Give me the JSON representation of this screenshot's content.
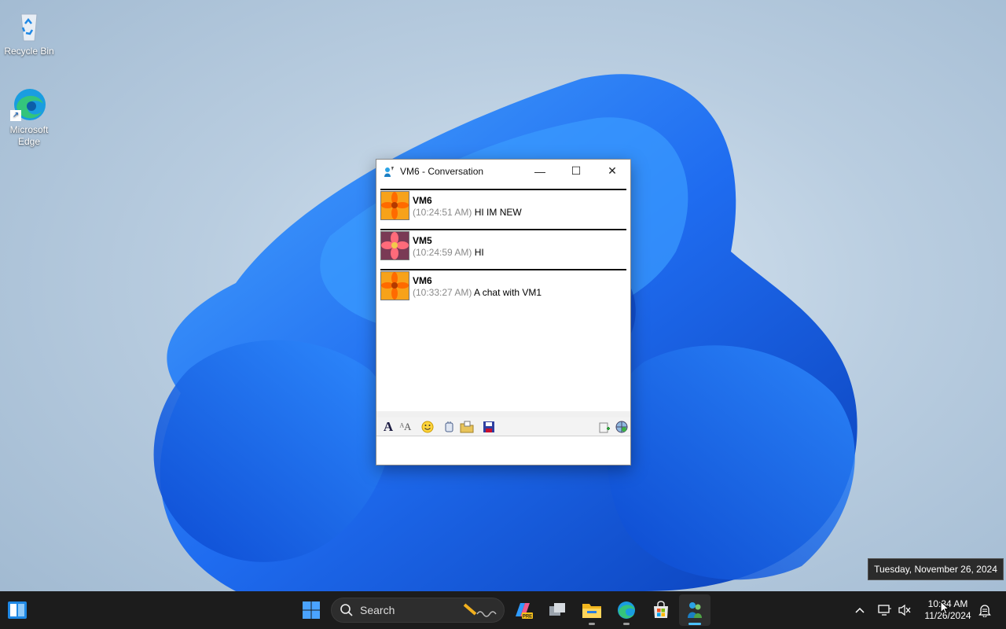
{
  "desktop": {
    "icons": [
      {
        "label": "Recycle Bin"
      },
      {
        "label": "Microsoft Edge"
      }
    ]
  },
  "window": {
    "title": "VM6 - Conversation",
    "controls": {
      "minimize": "—",
      "maximize": "☐",
      "close": "✕"
    },
    "messages": [
      {
        "sender": "VM6",
        "time": "(10:24:51 AM)",
        "text": "HI IM NEW",
        "avatar": "orange-flower"
      },
      {
        "sender": "VM5",
        "time": "(10:24:59 AM)",
        "text": "HI",
        "avatar": "pink-flower"
      },
      {
        "sender": "VM6",
        "time": "(10:33:27 AM)",
        "text": "A chat with VM1",
        "avatar": "orange-flower"
      }
    ],
    "input_value": ""
  },
  "tooltip": "Tuesday, November 26, 2024",
  "taskbar": {
    "search_label": "Search",
    "clock_time": "10:34 AM",
    "clock_date": "11/26/2024"
  },
  "colors": {
    "accent": "#4cc2ff",
    "taskbar": "#1c1c1c",
    "timestamp": "#8a8a8a"
  }
}
